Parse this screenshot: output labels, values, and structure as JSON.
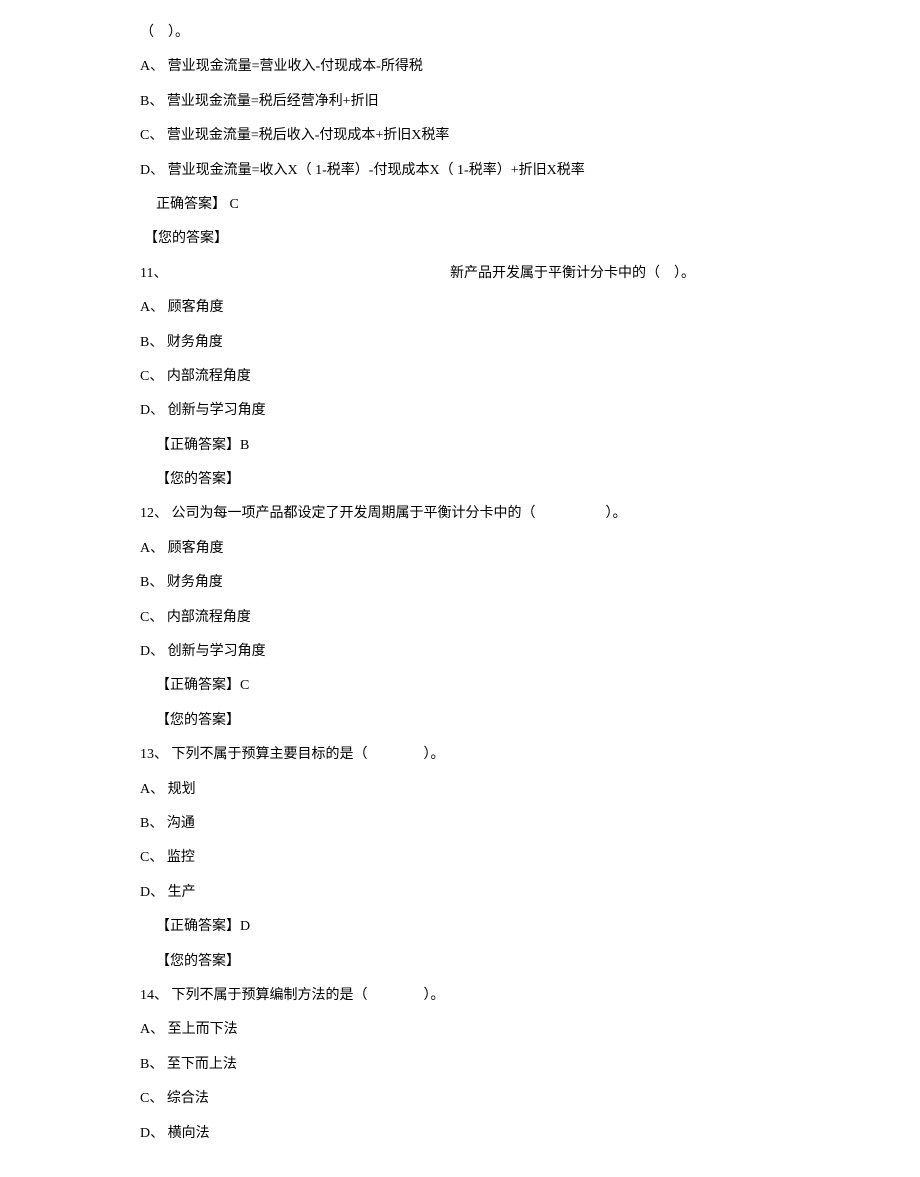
{
  "q10_tail": "（　）。",
  "q10": {
    "optA": "A、 营业现金流量=营业收入-付现成本-所得税",
    "optB": "B、 营业现金流量=税后经营净利+折旧",
    "optC": "C、 营业现金流量=税后收入-付现成本+折旧X税率",
    "optD": "D、 营业现金流量=收入X（ 1-税率）-付现成本X（ 1-税率）+折旧X税率",
    "correct": "正确答案】 C",
    "yours": "【您的答案】"
  },
  "q11": {
    "num": "11、",
    "stem": "新产品开发属于平衡计分卡中的（　）。",
    "optA": "A、 顾客角度",
    "optB": "B、 财务角度",
    "optC": "C、 内部流程角度",
    "optD": "D、 创新与学习角度",
    "correct": "【正确答案】B",
    "yours": "【您的答案】"
  },
  "q12": {
    "stem": "12、 公司为每一项产品都设定了开发周期属于平衡计分卡中的（　　　　　）。",
    "optA": "A、 顾客角度",
    "optB": "B、 财务角度",
    "optC": "C、 内部流程角度",
    "optD": "D、 创新与学习角度",
    "correct": "【正确答案】C",
    "yours": "【您的答案】"
  },
  "q13": {
    "stem": "13、 下列不属于预算主要目标的是（　　　　）。",
    "optA": "A、 规划",
    "optB": "B、 沟通",
    "optC": "C、 监控",
    "optD": "D、 生产",
    "correct": "【正确答案】D",
    "yours": "【您的答案】"
  },
  "q14": {
    "stem": "14、 下列不属于预算编制方法的是（　　　　）。",
    "optA": "A、 至上而下法",
    "optB": "B、 至下而上法",
    "optC": "C、 综合法",
    "optD": "D、 横向法"
  }
}
